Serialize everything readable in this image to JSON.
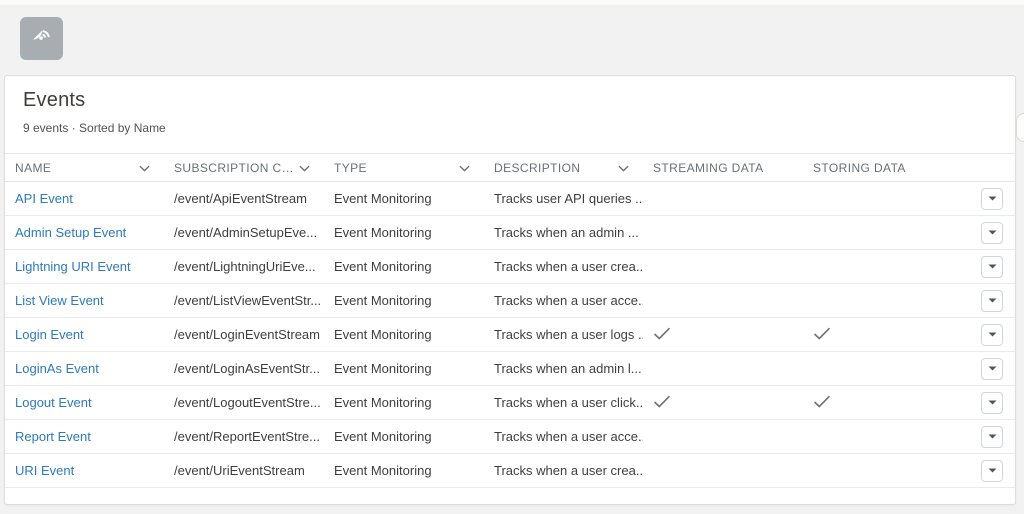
{
  "page": {
    "background_color": "#f3f2f2",
    "card_border_color": "#dedddc",
    "link_color": "#2d7abc",
    "check_color": "#6d7277"
  },
  "entity_header": {
    "icon": "events-broadcast-icon",
    "icon_bg_color": "#a8adb2"
  },
  "list_view": {
    "title": "Events",
    "subtitle": "9 events · Sorted by Name",
    "columns": [
      {
        "label": "NAME",
        "sortable": true
      },
      {
        "label": "SUBSCRIPTION CH...",
        "sortable": true
      },
      {
        "label": "TYPE",
        "sortable": true
      },
      {
        "label": "DESCRIPTION",
        "sortable": true
      },
      {
        "label": "STREAMING DATA",
        "sortable": false
      },
      {
        "label": "STORING DATA",
        "sortable": false
      }
    ],
    "rows": [
      {
        "name": "API Event",
        "channel": "/event/ApiEventStream",
        "type": "Event Monitoring",
        "description": "Tracks user API queries ...",
        "streaming_data": false,
        "storing_data": false
      },
      {
        "name": "Admin Setup Event",
        "channel": "/event/AdminSetupEve...",
        "type": "Event Monitoring",
        "description": "Tracks when an admin ...",
        "streaming_data": false,
        "storing_data": false
      },
      {
        "name": "Lightning URI Event",
        "channel": "/event/LightningUriEve...",
        "type": "Event Monitoring",
        "description": "Tracks when a user crea...",
        "streaming_data": false,
        "storing_data": false
      },
      {
        "name": "List View Event",
        "channel": "/event/ListViewEventStr...",
        "type": "Event Monitoring",
        "description": "Tracks when a user acce...",
        "streaming_data": false,
        "storing_data": false
      },
      {
        "name": "Login Event",
        "channel": "/event/LoginEventStream",
        "type": "Event Monitoring",
        "description": "Tracks when a user logs ...",
        "streaming_data": true,
        "storing_data": true
      },
      {
        "name": "LoginAs Event",
        "channel": "/event/LoginAsEventStr...",
        "type": "Event Monitoring",
        "description": "Tracks when an admin l...",
        "streaming_data": false,
        "storing_data": false
      },
      {
        "name": "Logout Event",
        "channel": "/event/LogoutEventStre...",
        "type": "Event Monitoring",
        "description": "Tracks when a user click...",
        "streaming_data": true,
        "storing_data": true
      },
      {
        "name": "Report Event",
        "channel": "/event/ReportEventStre...",
        "type": "Event Monitoring",
        "description": "Tracks when a user acce...",
        "streaming_data": false,
        "storing_data": false
      },
      {
        "name": "URI Event",
        "channel": "/event/UriEventStream",
        "type": "Event Monitoring",
        "description": "Tracks when a user crea...",
        "streaming_data": false,
        "storing_data": false
      }
    ]
  }
}
